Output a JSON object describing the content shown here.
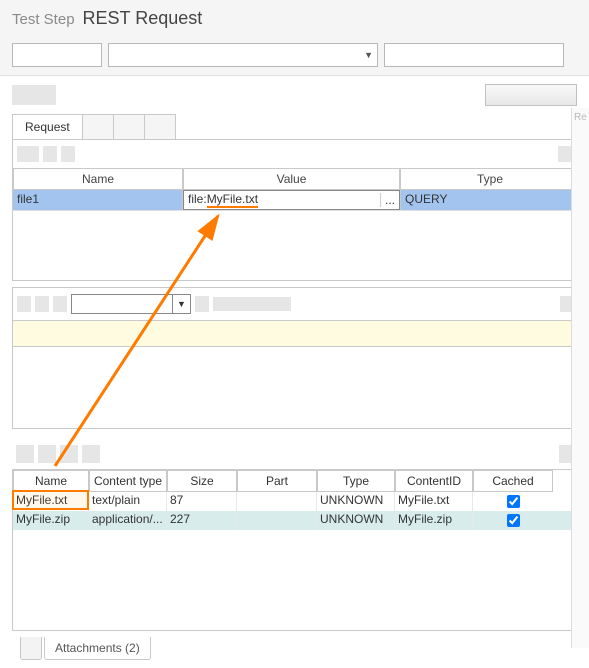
{
  "header": {
    "prefix": "Test Step",
    "title": "REST Request"
  },
  "main": {
    "tabLabel": "Request",
    "paramTable": {
      "headers": {
        "name": "Name",
        "value": "Value",
        "type": "Type"
      },
      "row": {
        "name": "file1",
        "value": "file:MyFile.txt",
        "type": "QUERY",
        "dots": "..."
      }
    }
  },
  "attachments": {
    "headers": {
      "name": "Name",
      "ct": "Content type",
      "size": "Size",
      "part": "Part",
      "type": "Type",
      "cid": "ContentID",
      "cached": "Cached"
    },
    "rows": [
      {
        "name": "MyFile.txt",
        "ct": "text/plain",
        "size": "87",
        "part": "",
        "type": "UNKNOWN",
        "cid": "MyFile.txt",
        "cached": true
      },
      {
        "name": "MyFile.zip",
        "ct": "application/...",
        "size": "227",
        "part": "",
        "type": "UNKNOWN",
        "cid": "MyFile.zip",
        "cached": true
      }
    ]
  },
  "footer": {
    "tabLabel": "Attachments  (2)"
  },
  "side": {
    "r": "Re"
  }
}
